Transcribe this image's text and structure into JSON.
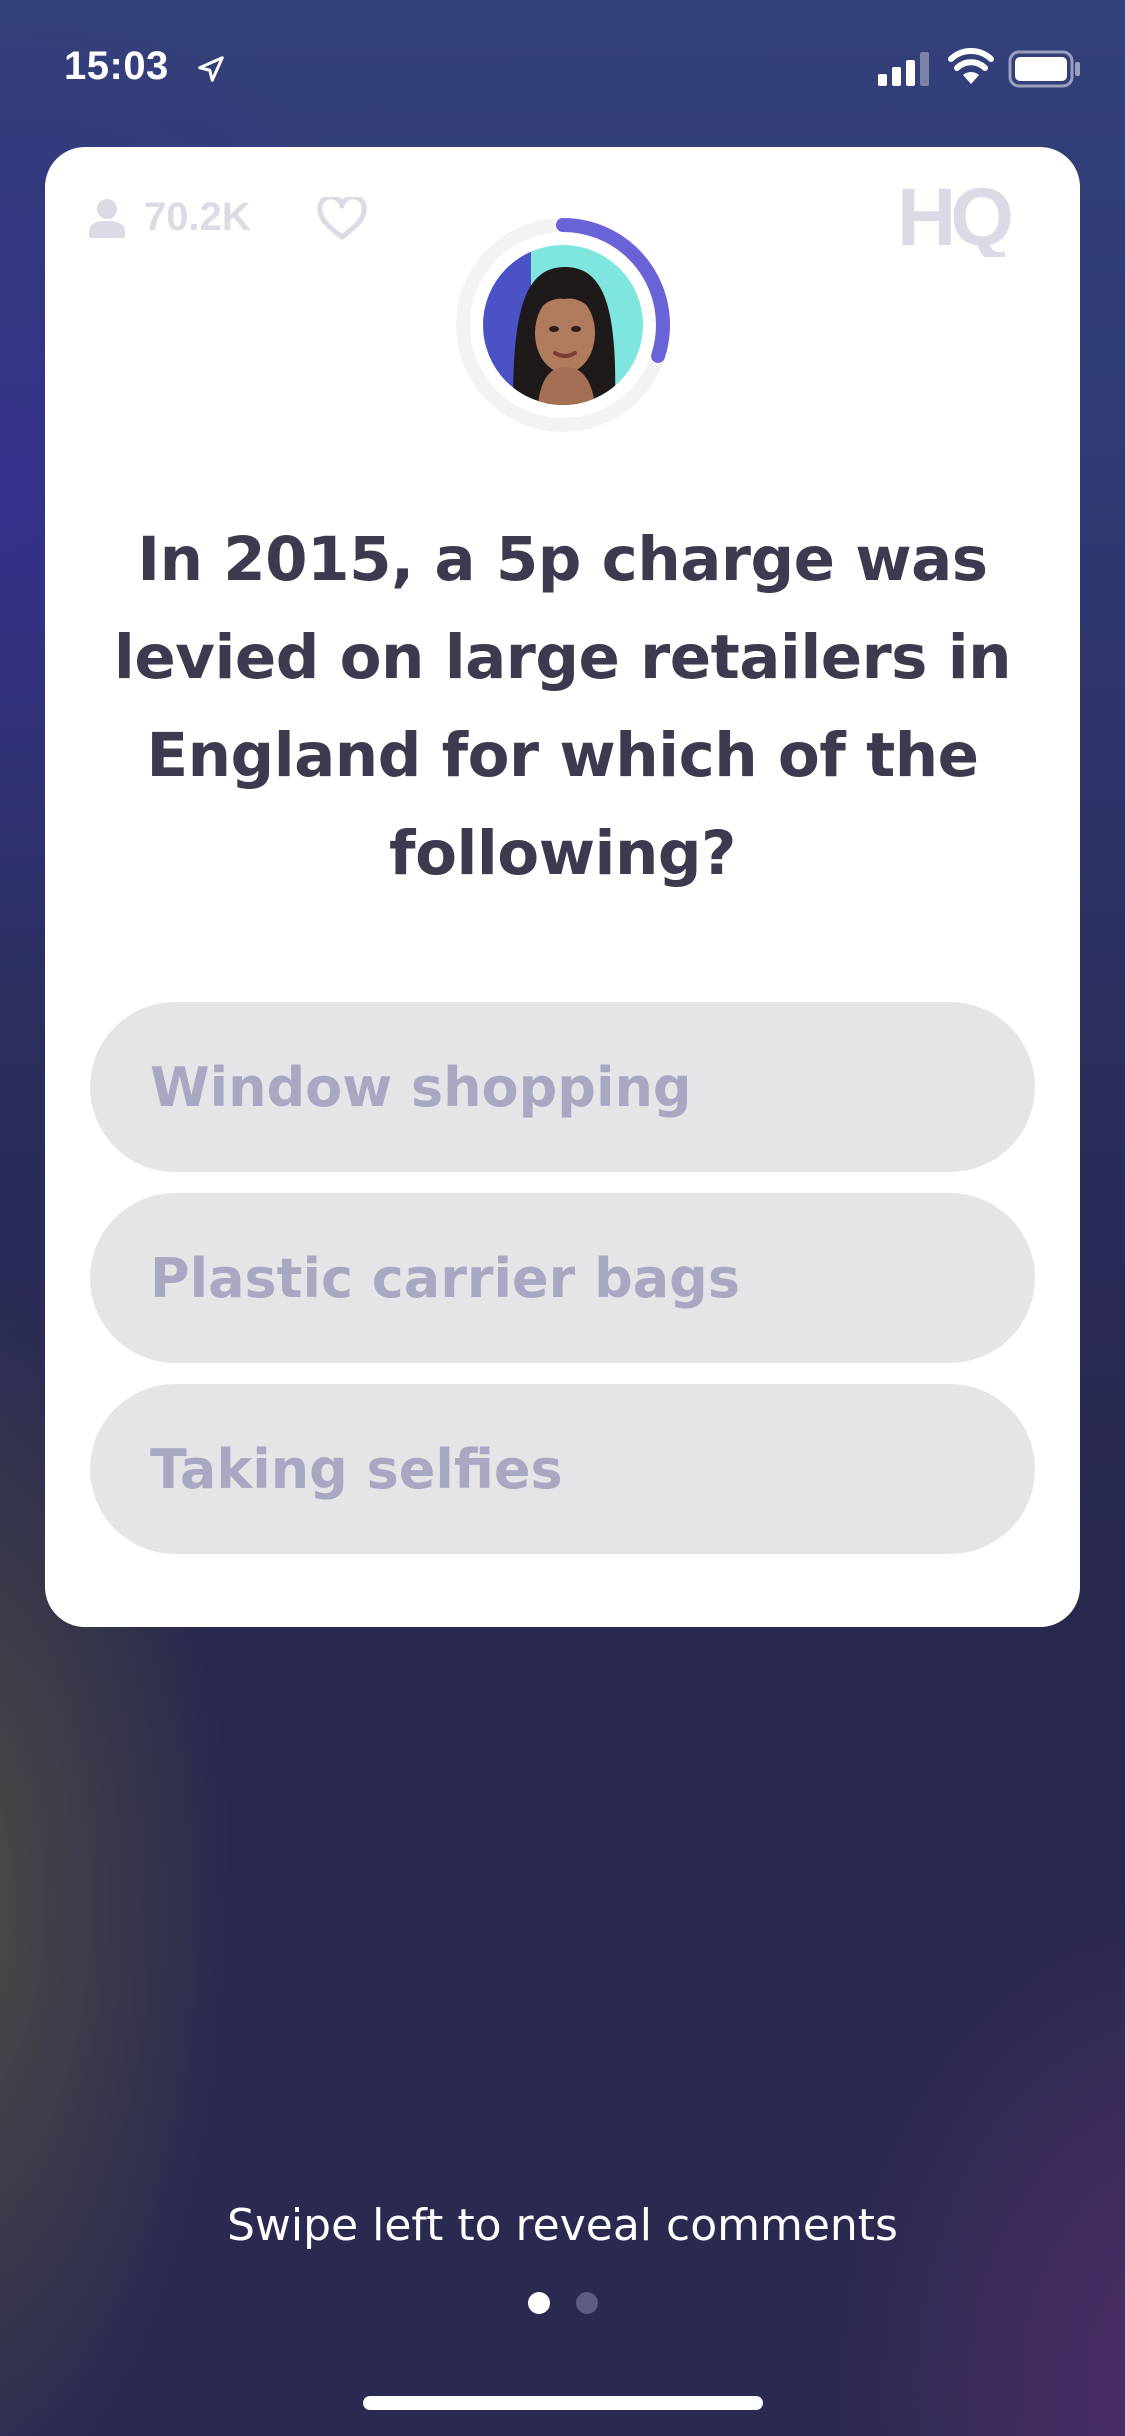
{
  "status_bar": {
    "time": "15:03",
    "icons": [
      "location-arrow-icon",
      "cellular-signal-icon",
      "wifi-icon",
      "battery-icon"
    ]
  },
  "card": {
    "viewer_count": "70.2K",
    "logo_text": "HQ",
    "icons": [
      "person-icon",
      "heart-icon"
    ],
    "question": "In 2015, a 5p charge was levied on large retailers in England for which of the following?",
    "answers": [
      {
        "label": "Window shopping"
      },
      {
        "label": "Plastic carrier bags"
      },
      {
        "label": "Taking selfies"
      }
    ],
    "timer_remaining_fraction": 0.3
  },
  "swipe_hint": "Swipe left to reveal comments",
  "pager": {
    "page_count": 2,
    "active_index": 0
  },
  "colors": {
    "accent": "#6a63d8",
    "question_text": "#3b3a4e",
    "answer_bg": "#e5e5e7",
    "answer_text": "#a9a8c2",
    "background": "#2b2c5a"
  }
}
